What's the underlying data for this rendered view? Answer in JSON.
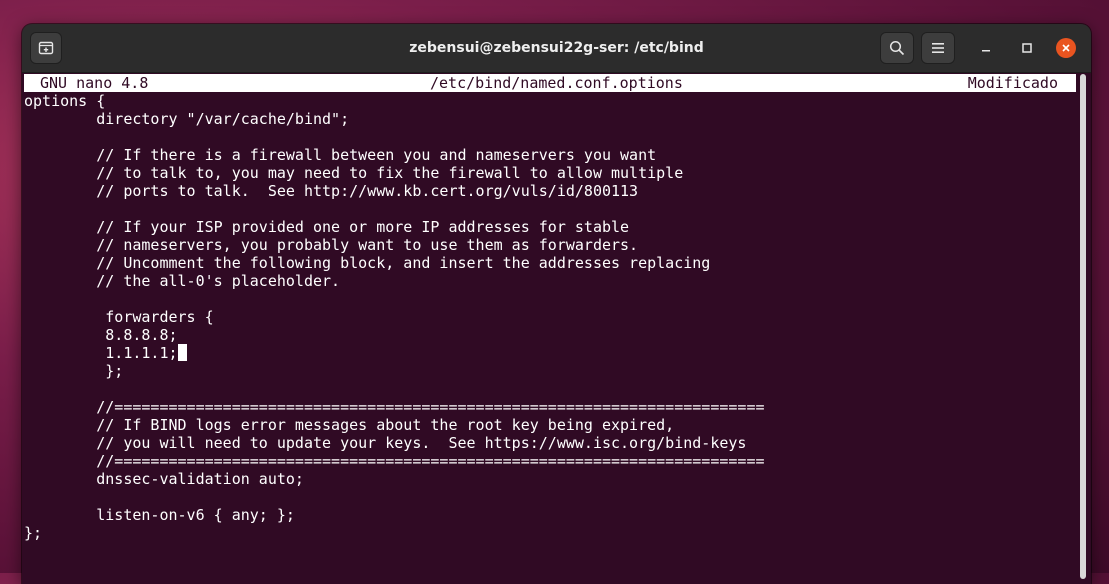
{
  "window": {
    "title": "zebensui@zebensui22g-ser: /etc/bind"
  },
  "titlebar_icons": {
    "new_tab": "new-tab-icon",
    "search": "search-icon",
    "menu": "hamburger-menu-icon",
    "minimize": "minimize-icon",
    "maximize": "maximize-icon",
    "close": "close-icon"
  },
  "colors": {
    "terminal_bg": "#300a24",
    "close_button": "#e95420",
    "titlebar_bg": "#2c2c2c"
  },
  "nano": {
    "version": "GNU nano 4.8",
    "filename": "/etc/bind/named.conf.options",
    "status": "Modificado"
  },
  "editor": {
    "lines": [
      "options {",
      "        directory \"/var/cache/bind\";",
      "",
      "        // If there is a firewall between you and nameservers you want",
      "        // to talk to, you may need to fix the firewall to allow multiple",
      "        // ports to talk.  See http://www.kb.cert.org/vuls/id/800113",
      "",
      "        // If your ISP provided one or more IP addresses for stable",
      "        // nameservers, you probably want to use them as forwarders.",
      "        // Uncomment the following block, and insert the addresses replacing",
      "        // the all-0's placeholder.",
      "",
      "         forwarders {",
      "         8.8.8.8;",
      "         1.1.1.1;",
      "         };",
      "",
      "        //========================================================================",
      "        // If BIND logs error messages about the root key being expired,",
      "        // you will need to update your keys.  See https://www.isc.org/bind-keys",
      "        //========================================================================",
      "        dnssec-validation auto;",
      "",
      "        listen-on-v6 { any; };",
      "};"
    ],
    "cursor_line": 14
  }
}
